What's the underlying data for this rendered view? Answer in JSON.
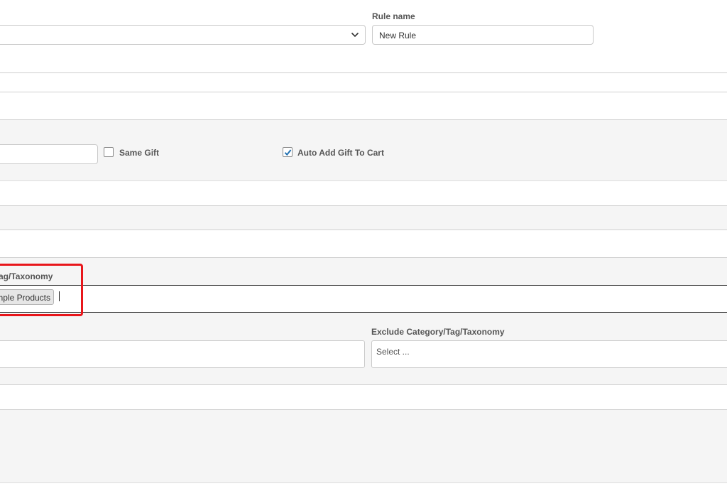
{
  "rule_name": {
    "label": "Rule name",
    "value": "New Rule"
  },
  "top_select": {
    "value": ""
  },
  "gift_options": {
    "same_gift": {
      "label": "Same Gift",
      "checked": false
    },
    "auto_add": {
      "label": "Auto Add Gift To Cart",
      "checked": true
    }
  },
  "include_taxonomy": {
    "label": "ag/Taxonomy",
    "selected_tag": "mple Products"
  },
  "exclude_taxonomy": {
    "label": "Exclude Category/Tag/Taxonomy",
    "placeholder": "Select ..."
  },
  "colors": {
    "highlight": "#e8161b",
    "checkbox_accent": "#2271b1",
    "band": "#f5f5f5"
  }
}
